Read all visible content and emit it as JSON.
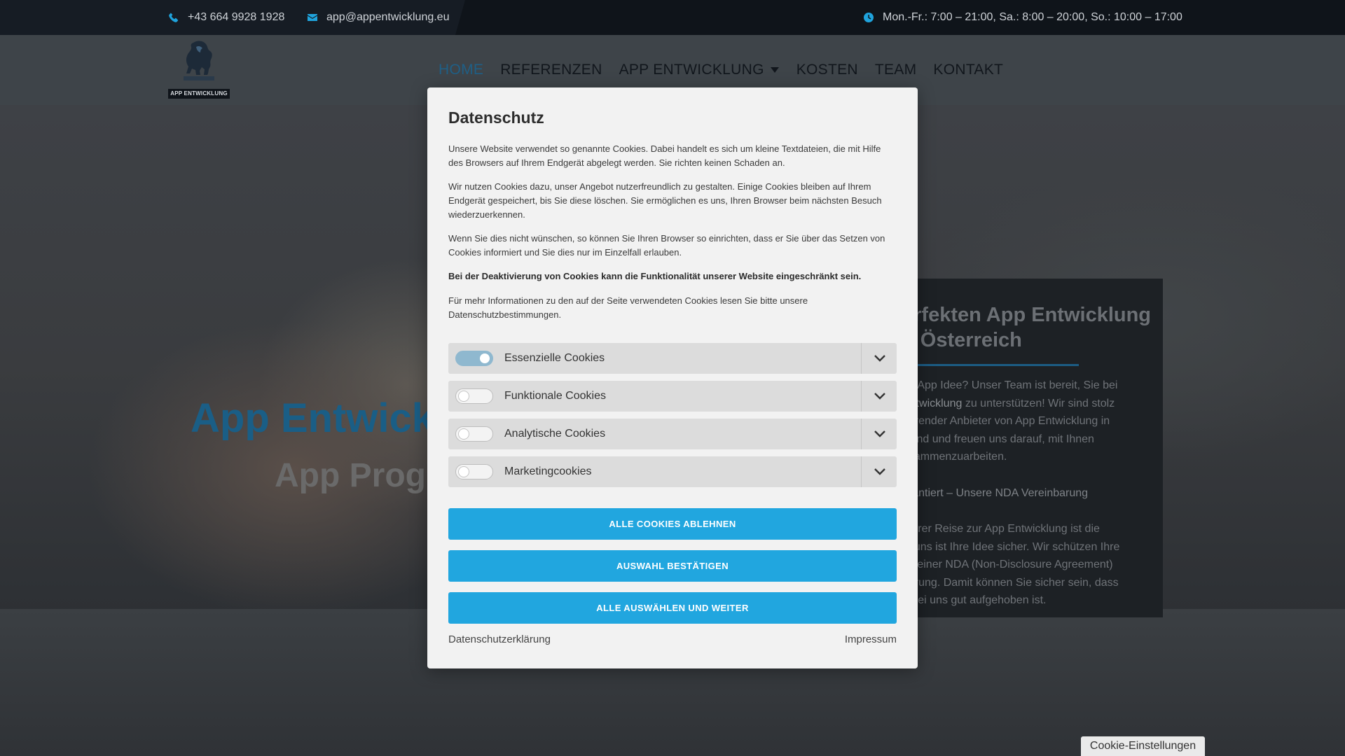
{
  "topbar": {
    "phone": "+43 664 9928 1928",
    "email": "app@appentwicklung.eu",
    "hours": "Mon.-Fr.: 7:00 – 21:00, Sa.: 8:00 – 20:00, So.: 10:00 – 17:00",
    "phone_icon": "phone-icon",
    "email_icon": "envelope-icon",
    "hours_icon": "clock-icon"
  },
  "header": {
    "logo_text": "APP ENTWICKLUNG",
    "nav": [
      "HOME",
      "REFERENZEN",
      "APP ENTWICKLUNG",
      "KOSTEN",
      "TEAM",
      "KONTAKT"
    ],
    "active": "HOME"
  },
  "hero": {
    "title": "App Entwick",
    "subtitle": "App Prog"
  },
  "infobox": {
    "title_line1": "erfekten App Entwicklung",
    "title_line2": "n Österreich",
    "p1_a": "de App Idee? Unser Team ist bereit, Sie bei",
    "p1_b_link": "Entwicklung",
    "p1_b_rest": " zu unterstützen! Wir sind stolz",
    "p1_c": "ührender Anbieter von App Entwicklung in",
    "p1_d": "t sind und freuen uns darauf, mit Ihnen",
    "p1_e": "usammenzuarbeiten.",
    "p2": "arantiert – Unsere NDA Vereinbarung",
    "p3_a": "f Ihrer Reise zur App Entwicklung ist die",
    "p3_b": "ei uns ist Ihre Idee sicher. Wir schützen Ihre",
    "p3_c": "nit einer NDA (Non-Disclosure Agreement)",
    "p3_d": "barung. Damit können Sie sicher sein, dass",
    "p3_e": "e bei uns gut aufgehoben ist."
  },
  "modal": {
    "title": "Datenschutz",
    "para1": "Unsere Website verwendet so genannte Cookies. Dabei handelt es sich um kleine Textdateien, die mit Hilfe des Browsers auf Ihrem Endgerät abgelegt werden. Sie richten keinen Schaden an.",
    "para2": "Wir nutzen Cookies dazu, unser Angebot nutzerfreundlich zu gestalten. Einige Cookies bleiben auf Ihrem Endgerät gespeichert, bis Sie diese löschen. Sie ermöglichen es uns, Ihren Browser beim nächsten Besuch wiederzuerkennen.",
    "para3": "Wenn Sie dies nicht wünschen, so können Sie Ihren Browser so einrichten, dass er Sie über das Setzen von Cookies informiert und Sie dies nur im Einzelfall erlauben.",
    "para4": "Bei der Deaktivierung von Cookies kann die Funktionalität unserer Website eingeschränkt sein.",
    "para5": "Für mehr Informationen zu den auf der Seite verwendeten Cookies lesen Sie bitte unsere Datenschutzbestimmungen.",
    "categories": [
      {
        "label": "Essenzielle Cookies",
        "enabled": true
      },
      {
        "label": "Funktionale Cookies",
        "enabled": false
      },
      {
        "label": "Analytische Cookies",
        "enabled": false
      },
      {
        "label": "Marketingcookies",
        "enabled": false
      }
    ],
    "btn_reject": "ALLE COOKIES ABLEHNEN",
    "btn_confirm": "AUSWAHL BESTÄTIGEN",
    "btn_accept_all": "ALLE AUSWÄHLEN UND WEITER",
    "link_privacy": "Datenschutzerklärung",
    "link_imprint": "Impressum"
  },
  "cookie_settings_tab": "Cookie-Einstellungen",
  "colors": {
    "accent": "#21a6df",
    "topbar_bg": "#161c24",
    "nav_active": "#1f5f86"
  }
}
